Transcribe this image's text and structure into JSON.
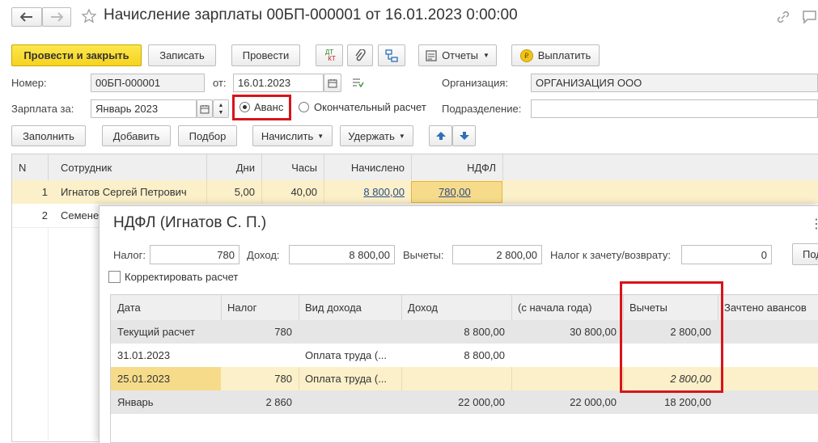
{
  "window": {
    "title": "Начисление зарплаты 00БП-000001 от 16.01.2023 0:00:00"
  },
  "toolbar": {
    "post_close": "Провести и закрыть",
    "save": "Записать",
    "post": "Провести",
    "dtkt_top": "ДТ",
    "dtkt_bottom": "КТ",
    "reports": "Отчеты",
    "pay": "Выплатить"
  },
  "form": {
    "number_label": "Номер:",
    "number_value": "00БП-000001",
    "from_label": "от:",
    "date_value": "16.01.2023",
    "org_label": "Организация:",
    "org_value": "ОРГАНИЗАЦИЯ ООО",
    "salary_for_label": "Зарплата за:",
    "salary_for_value": "Январь 2023",
    "radio_advance": "Аванс",
    "radio_final": "Окончательный расчет",
    "dept_label": "Подразделение:",
    "dept_value": ""
  },
  "actions": {
    "fill": "Заполнить",
    "add": "Добавить",
    "pick": "Подбор",
    "accrue": "Начислить",
    "deduct": "Удержать"
  },
  "main_table": {
    "headers": [
      "N",
      "Сотрудник",
      "Дни",
      "Часы",
      "Начислено",
      "НДФЛ"
    ],
    "rows": [
      {
        "n": "1",
        "employee": "Игнатов Сергей Петрович",
        "days": "5,00",
        "hours": "40,00",
        "accrued": "8 800,00",
        "ndfl": "780,00"
      },
      {
        "n": "2",
        "employee": "Семене"
      }
    ]
  },
  "popup": {
    "title": "НДФЛ (Игнатов С. П.)",
    "tax_label": "Налог:",
    "tax_value": "780",
    "income_label": "Доход:",
    "income_value": "8 800,00",
    "deductions_label": "Вычеты:",
    "deductions_value": "2 800,00",
    "offset_label": "Налог к зачету/возврату:",
    "offset_value": "0",
    "cut_button": "Под",
    "correct_checkbox": "Корректировать расчет",
    "headers": [
      "Дата",
      "Налог",
      "Вид дохода",
      "Доход",
      "(с начала года)",
      "Вычеты",
      "Зачтено авансов"
    ],
    "rows": [
      {
        "date": "Текущий расчет",
        "tax": "780",
        "kind": "",
        "income": "8 800,00",
        "ytd": "30 800,00",
        "deductions": "2 800,00",
        "advances": ""
      },
      {
        "date": "31.01.2023",
        "tax": "",
        "kind": "Оплата труда (...",
        "income": "8 800,00",
        "ytd": "",
        "deductions": "",
        "advances": ""
      },
      {
        "date": "25.01.2023",
        "tax": "780",
        "kind": "Оплата труда (...",
        "income": "",
        "ytd": "",
        "deductions": "2 800,00",
        "advances": ""
      },
      {
        "date": "Январь",
        "tax": "2 860",
        "kind": "",
        "income": "22 000,00",
        "ytd": "22 000,00",
        "deductions": "18 200,00",
        "advances": ""
      }
    ]
  },
  "colors": {
    "highlight_red": "#d7141a",
    "selected_row": "#fbf0c9",
    "selected_cell": "#f6dc8a",
    "primary_button": "#f6d320"
  }
}
